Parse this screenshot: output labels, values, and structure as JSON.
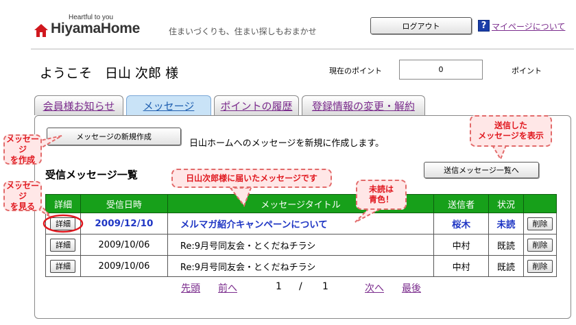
{
  "header": {
    "brand_small": "Heartful to you",
    "brand_name": "HiyamaHome",
    "tagline": "住まいづくりも、住まい探しもおまかせ",
    "logout_label": "ログアウト",
    "help_icon_glyph": "?",
    "mypage_help_label": "マイページについて"
  },
  "welcome": {
    "text": "ようこそ　日山 次郎 様",
    "points_label": "現在のポイント",
    "points_value": "0",
    "points_unit": "ポイント"
  },
  "tabs": [
    {
      "label": "会員様お知らせ",
      "active": false
    },
    {
      "label": "メッセージ",
      "active": true
    },
    {
      "label": "ポイントの履歴",
      "active": false
    },
    {
      "label": "登録情報の変更・解約",
      "active": false
    }
  ],
  "panel": {
    "new_message_button": "メッセージの新規作成",
    "new_message_desc": "日山ホームへのメッセージを新規に作成します。",
    "inbox_title": "受信メッセージ一覧",
    "sent_list_button": "送信メッセージ一覧へ"
  },
  "table": {
    "headers": [
      "詳細",
      "受信日時",
      "メッセージタイトル",
      "送信者",
      "状況",
      ""
    ],
    "detail_label": "詳細",
    "delete_label": "削除",
    "rows": [
      {
        "date": "2009/12/10",
        "title": "メルマガ紹介キャンペーンについて",
        "sender": "桜木",
        "status": "未読"
      },
      {
        "date": "2009/10/06",
        "title": "Re:9月号同友会・とくだねチラシ",
        "sender": "中村",
        "status": "既読"
      },
      {
        "date": "2009/10/06",
        "title": "Re:9月号同友会・とくだねチラシ",
        "sender": "中村",
        "status": "既読"
      }
    ]
  },
  "pager": {
    "first": "先頭",
    "prev": "前へ",
    "current": "1",
    "separator": "/",
    "total": "1",
    "next": "次へ",
    "last": "最後"
  },
  "callouts": {
    "create": "メッセージ\nを作成",
    "view": "メッセージ\nを見る",
    "received": "日山次郎様に届いたメッセージです",
    "unread": "未読は\n青色！",
    "sent": "送信した\nメッセージを表示"
  },
  "colors": {
    "table_header": "#17a01a",
    "unread_text": "#1f36c4",
    "callout_text": "#e0171e",
    "callout_bg": "#ffe7e7",
    "link": "#7a2b8c",
    "active_tab": "#c9e3f7"
  }
}
